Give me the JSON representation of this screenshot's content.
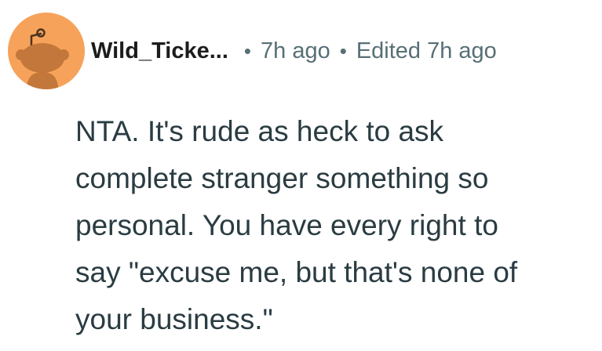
{
  "comment": {
    "username": "Wild_Ticke...",
    "separator": "•",
    "time": "7h ago",
    "edited": "Edited 7h ago",
    "lines": [
      "NTA. It's rude as heck to ask",
      "complete stranger something so",
      "personal. You have every right to",
      "say \"excuse me, but that's none of",
      "your business.\""
    ]
  },
  "colors": {
    "avatar_background": "#f7a25a",
    "avatar_figure": "#c4773a",
    "username": "#1c1c1c",
    "meta": "#576f76",
    "body_text": "#2a3c42"
  },
  "icons": {
    "avatar": "reddit-snoo-avatar"
  }
}
